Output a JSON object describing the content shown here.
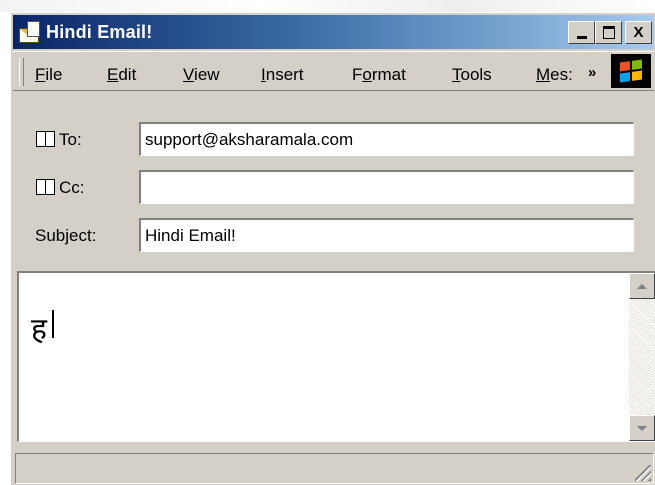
{
  "window": {
    "title": "Hindi Email!",
    "controls": [
      "minimize",
      "maximize",
      "close"
    ],
    "close_glyph": "X"
  },
  "menu": {
    "items": [
      {
        "label": "File",
        "mnemonic": "F"
      },
      {
        "label": "Edit",
        "mnemonic": "E"
      },
      {
        "label": "View",
        "mnemonic": "V"
      },
      {
        "label": "Insert",
        "mnemonic": "I"
      },
      {
        "label": "Format",
        "mnemonic": "o"
      },
      {
        "label": "Tools",
        "mnemonic": "T"
      },
      {
        "label": "Mes:",
        "mnemonic": "M"
      }
    ],
    "overflow": "»"
  },
  "header": {
    "to_label": "To:",
    "to_value": "support@aksharamala.com",
    "cc_label": "Cc:",
    "cc_value": "",
    "subject_label": "Subject:",
    "subject_value": "Hindi Email!"
  },
  "body": {
    "text": "ह"
  },
  "icons": {
    "app": "envelope-icon",
    "address_book": "address-book-icon",
    "windows_logo": "windows-logo-icon"
  },
  "colors": {
    "titlebar_start": "#0a246a",
    "titlebar_end": "#a6caf0",
    "face": "#d4d0c8"
  }
}
